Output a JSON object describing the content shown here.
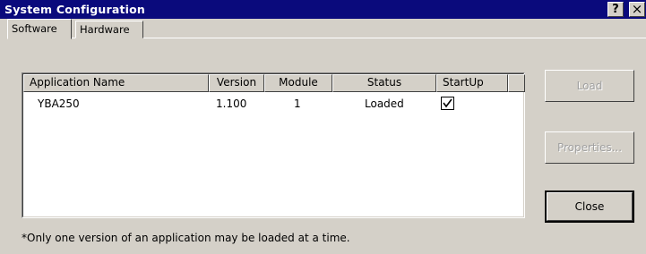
{
  "window": {
    "title": "System Configuration",
    "help_label": "?",
    "close_label": "×"
  },
  "tabs": [
    {
      "label": "Software",
      "active": true
    },
    {
      "label": "Hardware",
      "active": false
    }
  ],
  "list": {
    "columns": [
      "Application Name",
      "Version",
      "Module",
      "Status",
      "StartUp"
    ],
    "rows": [
      {
        "name": "YBA250",
        "version": "1.100",
        "module": "1",
        "status": "Loaded",
        "startup": true
      }
    ]
  },
  "buttons": {
    "load": "Load",
    "properties": "Properties...",
    "close": "Close"
  },
  "footnote": "*Only one version of an application may be loaded at a time.",
  "colors": {
    "titlebar": "#0a0a7c",
    "face": "#d4d0c8",
    "disabled_text": "#a0a0a0"
  }
}
